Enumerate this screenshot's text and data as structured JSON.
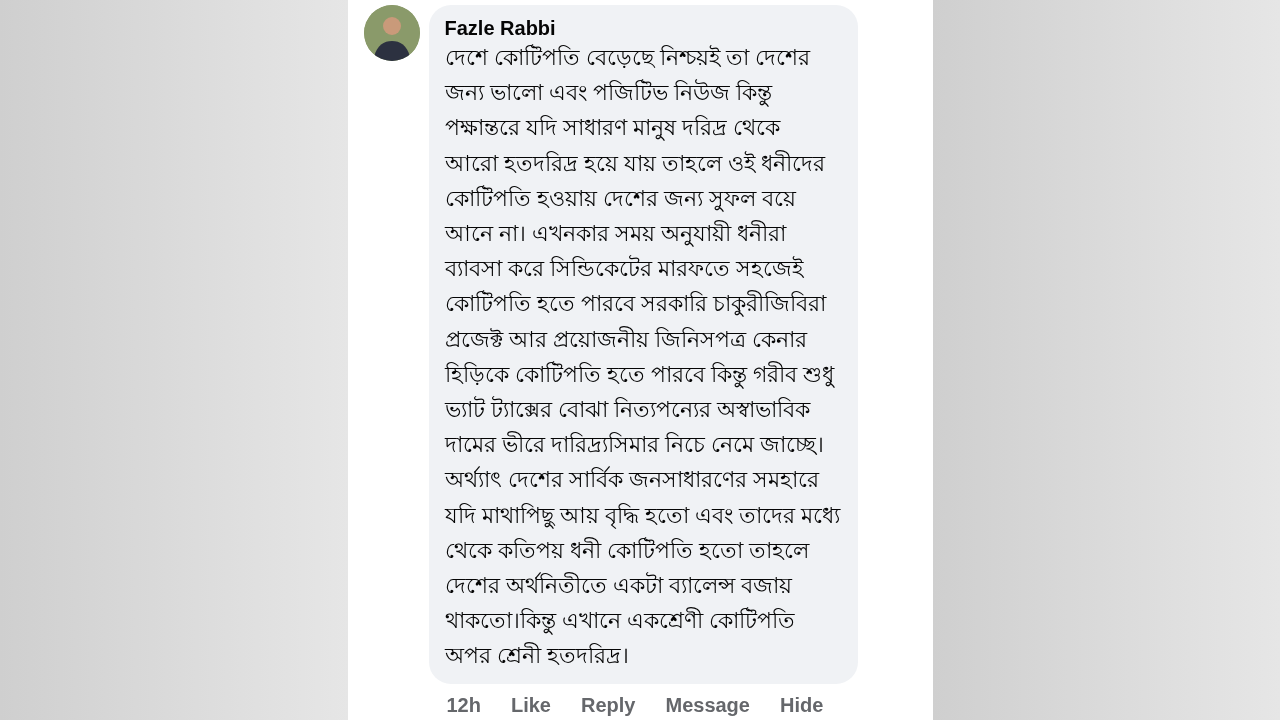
{
  "comment": {
    "author": "Fazle Rabbi",
    "text": "দেশে কোটিপতি বেড়েছে নিশ্চয়ই তা দেশের\nজন্য ভালো এবং পজিটিভ নিউজ কিন্তু\nপক্ষান্তরে যদি সাধারণ মানুষ দরিদ্র থেকে\nআরো হতদরিদ্র হয়ে যায় তাহলে ওই ধনীদের\nকোটিপতি হওয়ায় দেশের জন্য সুফল বয়ে\nআনে না। এখনকার সময় অনুযায়ী ধনীরা\nব্যাবসা করে সিন্ডিকেটের মারফতে সহজেই\nকোটিপতি হতে পারবে সরকারি চাকুরীজিবিরা\nপ্রজেক্ট আর প্রয়োজনীয় জিনিসপত্র কেনার\nহিড়িকে কোটিপতি হতে পারবে কিন্তু গরীব শুধু\nভ্যাট ট্যাক্সের বোঝা নিত্যপন্যের অস্বাভাবিক\nদামের ভীরে দারিদ্র্যসিমার নিচে নেমে জাচ্ছে।\nঅর্থ্যাৎ দেশের সার্বিক জনসাধারণের সমহারে\nযদি মাথাপিছু আয় বৃদ্ধি হতো এবং তাদের মধ্যে\nথেকে কতিপয় ধনী কোটিপতি হতো তাহলে\nদেশের অর্থনিতীতে একটা ব্যালেন্স বজায়\nথাকতো।কিন্তু এখানে একশ্রেণী কোটিপতি\nঅপর শ্রেনী হতদরিদ্র।",
    "time": "12h",
    "actions": [
      "Like",
      "Reply",
      "Message",
      "Hide"
    ]
  }
}
